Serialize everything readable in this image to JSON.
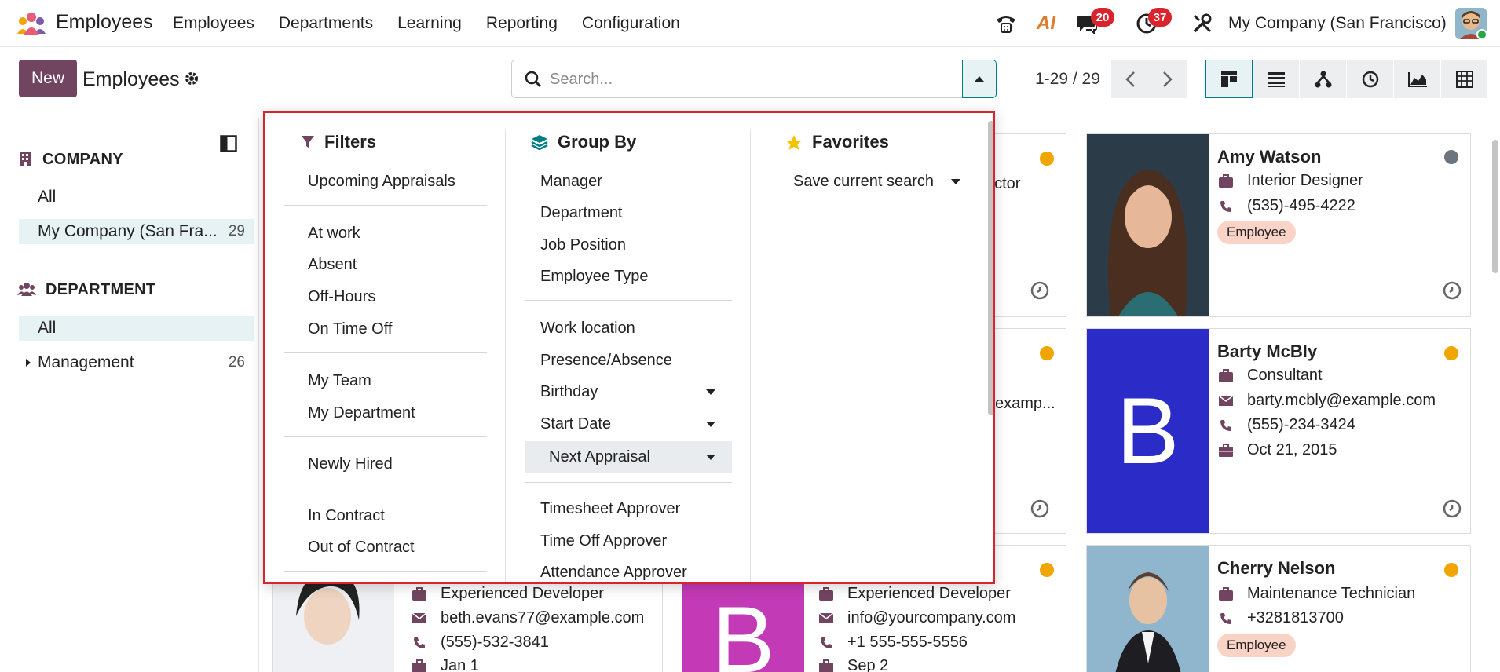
{
  "navbar": {
    "app_name": "Employees",
    "menu": [
      "Employees",
      "Departments",
      "Learning",
      "Reporting",
      "Configuration"
    ],
    "chat_badge": "20",
    "activity_badge": "37",
    "ai_label": "AI",
    "company": "My Company (San Francisco)"
  },
  "control_panel": {
    "new_label": "New",
    "title": "Employees",
    "search_placeholder": "Search...",
    "pager": "1-29 / 29"
  },
  "sidebar": {
    "company_header": "COMPANY",
    "company_items": [
      {
        "label": "All",
        "count": ""
      },
      {
        "label": "My Company (San Fra...",
        "count": "29"
      }
    ],
    "department_header": "DEPARTMENT",
    "department_items": [
      {
        "label": "All",
        "count": ""
      },
      {
        "label": "Management",
        "count": "26"
      }
    ]
  },
  "dropdown": {
    "filters_header": "Filters",
    "filters": [
      "Upcoming Appraisals",
      "At work",
      "Absent",
      "Off-Hours",
      "On Time Off",
      "My Team",
      "My Department",
      "Newly Hired",
      "In Contract",
      "Out of Contract"
    ],
    "groupby_header": "Group By",
    "groupby": [
      "Manager",
      "Department",
      "Job Position",
      "Employee Type",
      "Work location",
      "Presence/Absence",
      "Birthday",
      "Start Date",
      "Next Appraisal",
      "Timesheet Approver",
      "Time Off Approver",
      "Attendance Approver"
    ],
    "favorites_header": "Favorites",
    "save_search": "Save current search"
  },
  "cards": {
    "amy": {
      "name": "Amy Watson",
      "job": "Interior Designer",
      "phone": "(535)-495-4222",
      "tag": "Employee"
    },
    "barty": {
      "name": "Barty McBly",
      "job": "Consultant",
      "email": "barty.mcbly@example.com",
      "phone": "(555)-234-3424",
      "date": "Oct 21, 2015",
      "initial": "B"
    },
    "cherry": {
      "name": "Cherry Nelson",
      "job": "Maintenance Technician",
      "phone": "+3281813700",
      "tag": "Employee"
    },
    "beth": {
      "job": "Experienced Developer",
      "email": "beth.evans77@example.com",
      "phone": "(555)-532-3841",
      "date": "Jan 1"
    },
    "info": {
      "job": "Experienced Developer",
      "email": "info@yourcompany.com",
      "phone": "+1 555-555-5556",
      "date": "Sep 2",
      "initial": "B"
    },
    "partial1": {
      "job_tail": "ector"
    },
    "partial2": {
      "email_tail": "examp..."
    }
  },
  "colors": {
    "brand": "#71455f",
    "accent": "#017e84",
    "badge": "#d9232d",
    "status_orange": "#f0a500",
    "status_grey": "#6c757d",
    "highlight_border": "#d9232d"
  }
}
